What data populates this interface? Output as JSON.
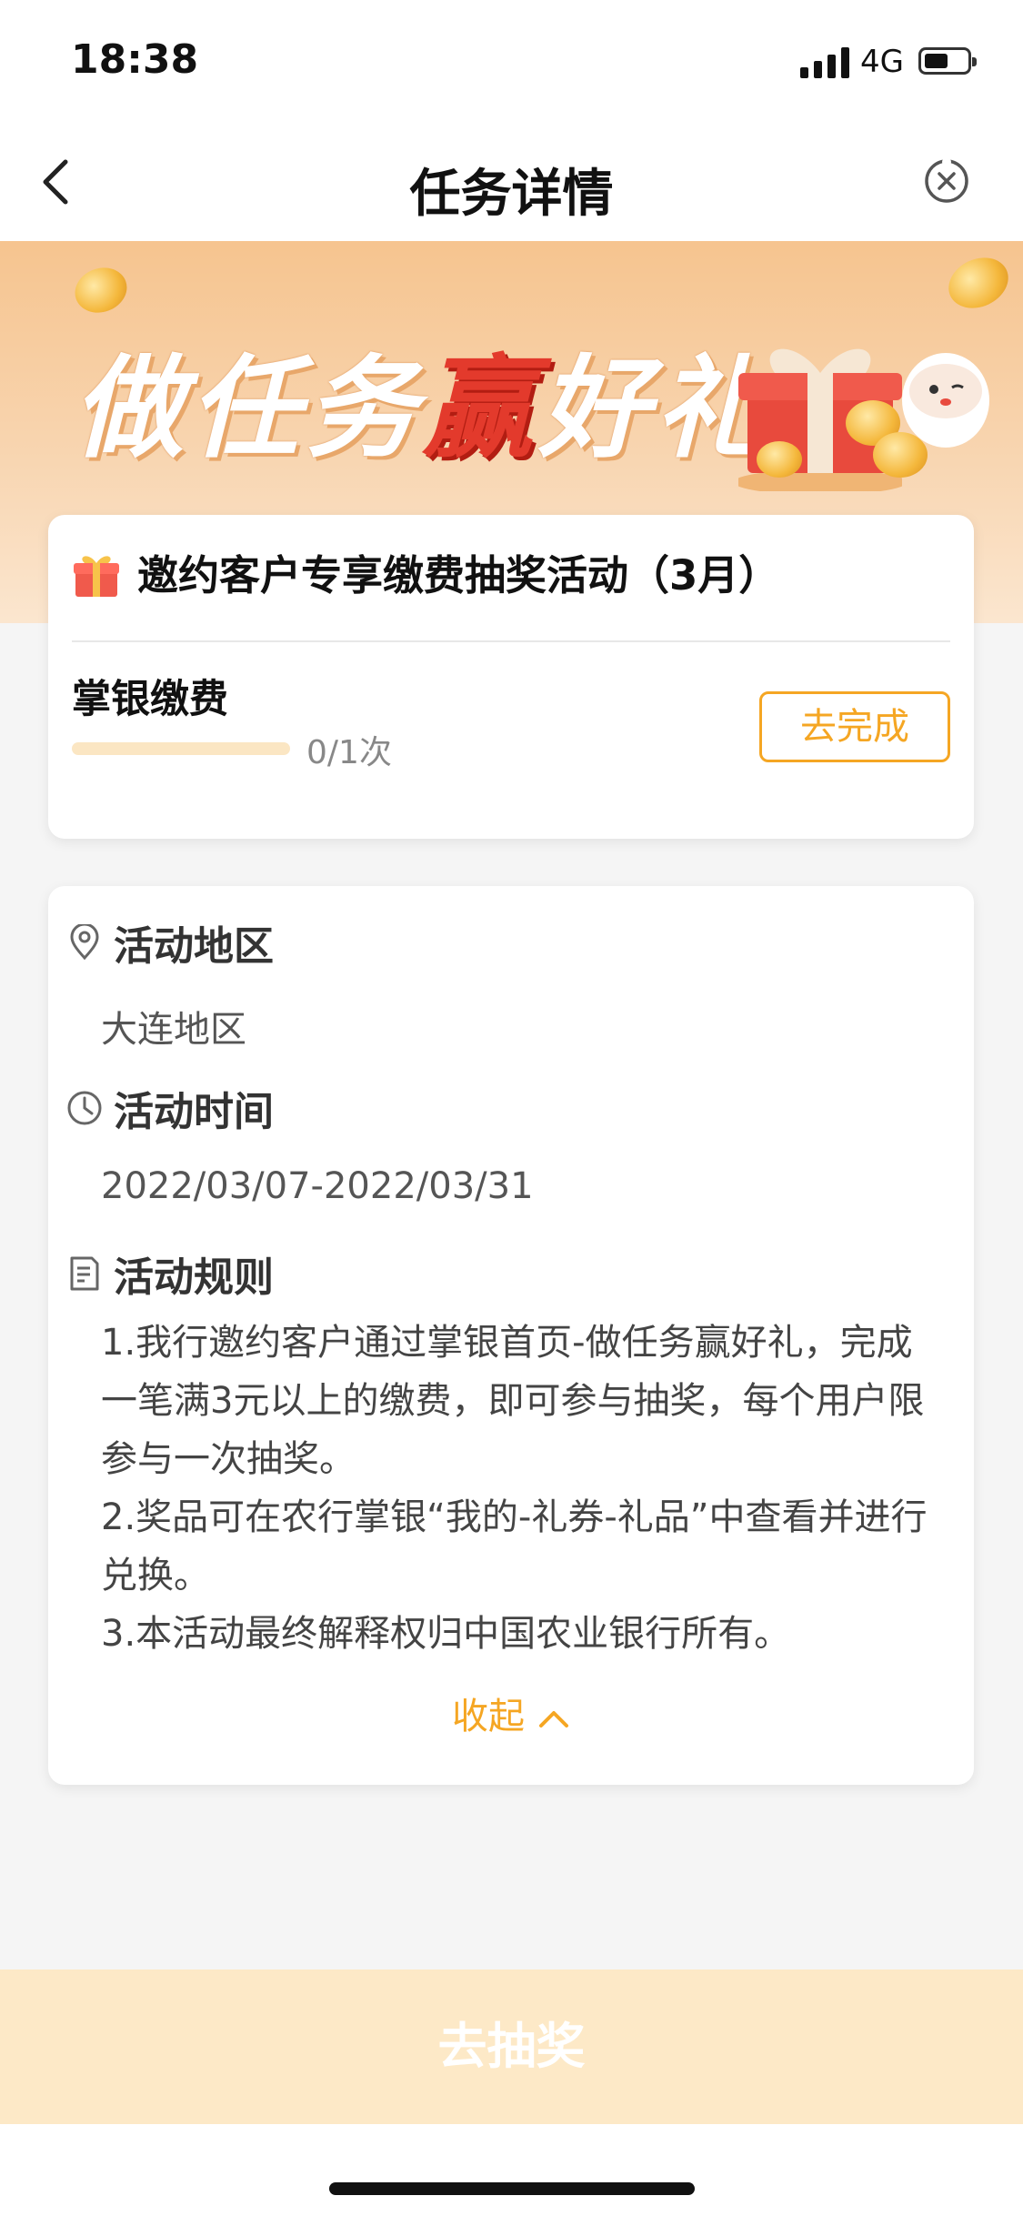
{
  "status": {
    "time": "18:38",
    "network": "4G",
    "battery_level": 0.55
  },
  "nav": {
    "title": "任务详情"
  },
  "banner": {
    "text_pre": "做任务",
    "text_highlight": "赢",
    "text_post": "好礼"
  },
  "task_card": {
    "title": "邀约客户专享缴费抽奖活动（3月）",
    "task_name": "掌银缴费",
    "progress_text": "0/1次",
    "progress_fraction": 0,
    "complete_label": "去完成"
  },
  "info": {
    "region_label": "活动地区",
    "region_value": "大连地区",
    "time_label": "活动时间",
    "time_value": "2022/03/07-2022/03/31",
    "rules_label": "活动规则",
    "rules": [
      "1.我行邀约客户通过掌银首页-做任务赢好礼，完成一笔满3元以上的缴费，即可参与抽奖，每个用户限参与一次抽奖。",
      "2.奖品可在农行掌银“我的-礼券-礼品”中查看并进行兑换。",
      "3.本活动最终解释权归中国农业银行所有。"
    ],
    "collapse_label": "收起"
  },
  "bottom": {
    "draw_label": "去抽奖"
  },
  "colors": {
    "accent": "#f5a623",
    "banner": "#f6c48f",
    "highlight_red": "#e33a2c",
    "button_disabled": "#fde9c7"
  }
}
